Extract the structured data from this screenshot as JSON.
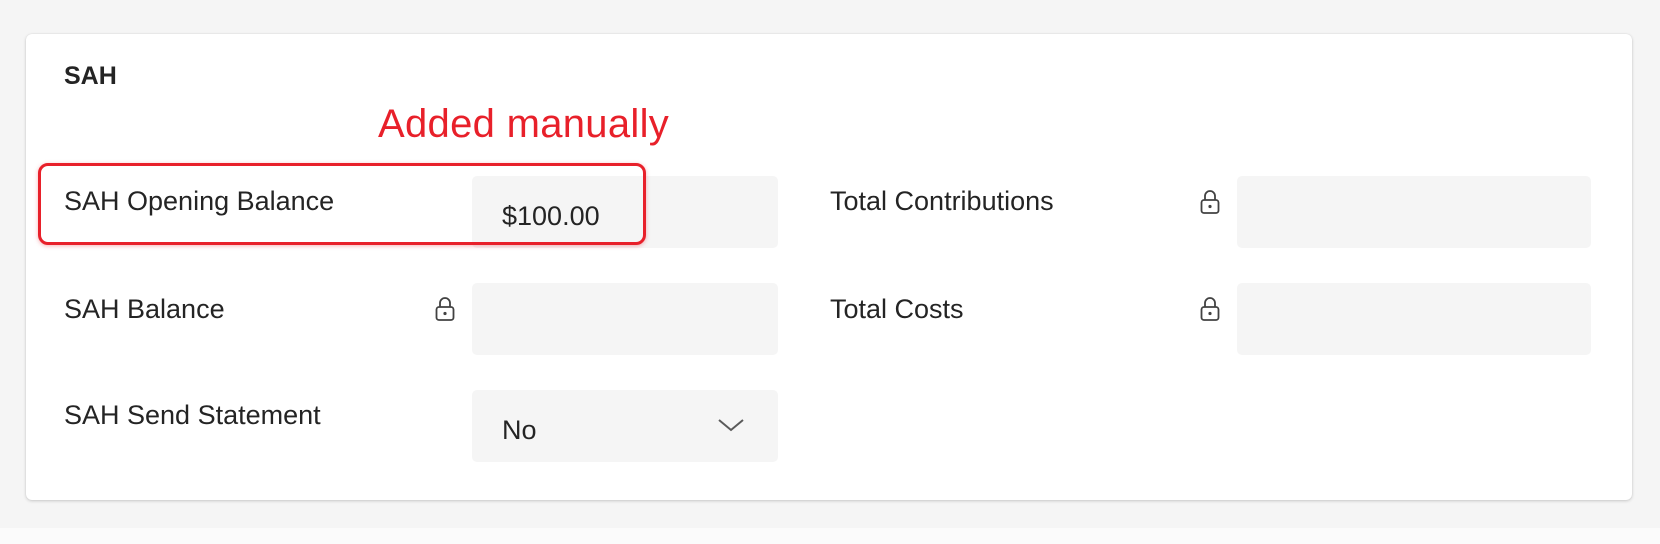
{
  "section": {
    "title": "SAH"
  },
  "annotation": {
    "text": "Added manually",
    "color": "#e8202a"
  },
  "fields": {
    "opening_balance": {
      "label": "SAH Opening Balance",
      "value": "$100.00"
    },
    "balance": {
      "label": "SAH Balance",
      "value": "",
      "icon": "lock-icon"
    },
    "send_statement": {
      "label": "SAH Send Statement",
      "value": "No",
      "icon": "chevron-down-icon"
    },
    "total_contributions": {
      "label": "Total Contributions",
      "value": "",
      "icon": "lock-icon"
    },
    "total_costs": {
      "label": "Total Costs",
      "value": "",
      "icon": "lock-icon"
    }
  }
}
